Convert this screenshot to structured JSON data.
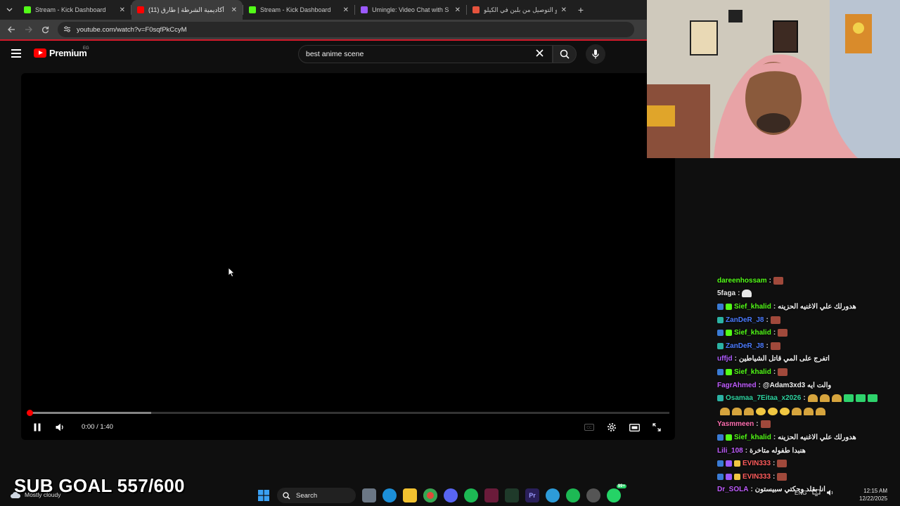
{
  "browser": {
    "tabs": [
      {
        "title": "Stream - Kick Dashboard",
        "favicon_color": "#53fc18",
        "active": false
      },
      {
        "title": "(11) أكاديمية الشرطة | طارق",
        "favicon_color": "#ff0000",
        "active": true
      },
      {
        "title": "Stream - Kick Dashboard",
        "favicon_color": "#53fc18",
        "active": false
      },
      {
        "title": "Umingle: Video Chat with S",
        "favicon_color": "#9b59ff",
        "active": false
      },
      {
        "title": "منيو التوصيل من بلبن في الكيلو",
        "favicon_color": "#e5533d",
        "active": false
      }
    ],
    "url": "youtube.com/watch?v=F0sqfPkCcyM"
  },
  "youtube": {
    "logo_text": "Premium",
    "country_code": "EG",
    "search_query": "best anime scene"
  },
  "player": {
    "time_display": "0:00 / 1:40",
    "progress_fraction": 0.0,
    "buffered_fraction": 0.19,
    "state": "playing"
  },
  "chat": {
    "messages": [
      {
        "user": "dareenhossam",
        "user_color": "#53fc18",
        "badges": [],
        "text": "",
        "emotes": [
          "sticker"
        ]
      },
      {
        "user": "5faga",
        "user_color": "#e8e8e8",
        "badges": [],
        "text": "",
        "emotes": [
          "ghost"
        ]
      },
      {
        "user": "Sief_khalid",
        "user_color": "#53fc18",
        "badges": [
          "#3a7bd5",
          "#53fc18"
        ],
        "text": "هدورلك علي الاغنيه الحزينه",
        "emotes": []
      },
      {
        "user": "ZanDeR_J8",
        "user_color": "#4a7bff",
        "badges": [
          "#2bb3a4"
        ],
        "text": "",
        "emotes": [
          "sticker"
        ]
      },
      {
        "user": "Sief_khalid",
        "user_color": "#53fc18",
        "badges": [
          "#3a7bd5",
          "#53fc18"
        ],
        "text": "",
        "emotes": [
          "sticker"
        ]
      },
      {
        "user": "ZanDeR_J8",
        "user_color": "#4a7bff",
        "badges": [
          "#2bb3a4"
        ],
        "text": "",
        "emotes": [
          "sticker"
        ]
      },
      {
        "user": "uffjd",
        "user_color": "#b05cff",
        "badges": [],
        "text": "اتفرج على المي قاتل الشياطين",
        "emotes": []
      },
      {
        "user": "Sief_khalid",
        "user_color": "#53fc18",
        "badges": [
          "#3a7bd5",
          "#53fc18"
        ],
        "text": "",
        "emotes": [
          "sticker"
        ]
      },
      {
        "user": "FagrAhmed",
        "user_color": "#c05cff",
        "badges": [],
        "text": "@Adam3xd3 والت ايه",
        "emotes": []
      },
      {
        "user": "Osamaa_7Eitaa_x2026",
        "user_color": "#2ed3a0",
        "badges": [
          "#2bb3a4"
        ],
        "text": "",
        "emotes": [
          "cop",
          "cop",
          "cop",
          "green",
          "green",
          "green"
        ]
      },
      {
        "user": "",
        "user_color": "#ffffff",
        "badges": [],
        "text": "",
        "emotes": [
          "cop",
          "cop",
          "cop",
          "star",
          "star",
          "star",
          "cop",
          "cop",
          "cop"
        ]
      },
      {
        "user": "Yasmmeen",
        "user_color": "#ff6fb0",
        "badges": [],
        "text": "",
        "emotes": [
          "sticker"
        ]
      },
      {
        "user": "Sief_khalid",
        "user_color": "#53fc18",
        "badges": [
          "#3a7bd5",
          "#53fc18"
        ],
        "text": "هدورلك علي الاغنيه الحزينه",
        "emotes": []
      },
      {
        "user": "Lili_108",
        "user_color": "#c05cff",
        "badges": [],
        "text": "هنبدا طفوله متاخرة",
        "emotes": []
      },
      {
        "user": "EVIN333",
        "user_color": "#ff5c5c",
        "badges": [
          "#3a7bd5",
          "#9b59ff",
          "#f0c742"
        ],
        "text": "",
        "emotes": [
          "sticker"
        ]
      },
      {
        "user": "EVIN333",
        "user_color": "#ff5c5c",
        "badges": [
          "#3a7bd5",
          "#9b59ff",
          "#f0c742"
        ],
        "text": "",
        "emotes": [
          "sticker"
        ]
      },
      {
        "user": "Dr_SOLA",
        "user_color": "#c05cff",
        "badges": [],
        "text": "انا بقلد وحكتي سبيستون",
        "emotes": []
      }
    ]
  },
  "overlay": {
    "sub_goal": "SUB GOAL 557/600"
  },
  "taskbar": {
    "weather": "Mostly cloudy",
    "search_label": "Search",
    "language": "ENG",
    "time": "12:15 AM",
    "date": "12/22/2025",
    "notification_count": "99+"
  }
}
